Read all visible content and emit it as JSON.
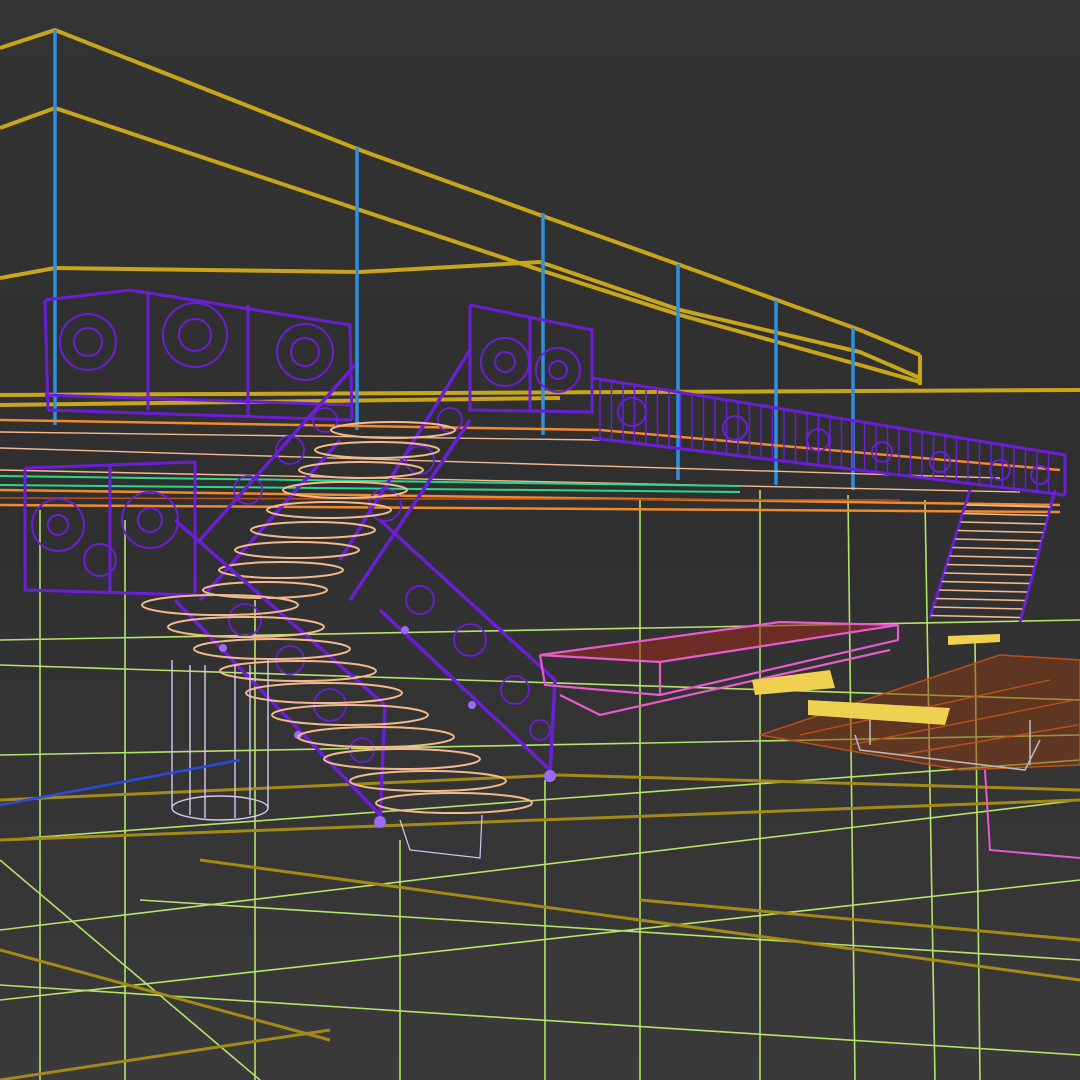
{
  "viewport": {
    "background_color": "#333333",
    "render_mode": "wireframe",
    "colors": {
      "walls": "#c9a51a",
      "columns": "#2f8fe0",
      "floor_grid": "#b5e36a",
      "railings": "#6a1fd6",
      "steps": "#f3b98c",
      "slab_edge": "#f08a2a",
      "bench": "#e85ad0",
      "pillar": "#d8c8f0",
      "rug": "#c0501a",
      "cushion": "#f0d050"
    }
  }
}
